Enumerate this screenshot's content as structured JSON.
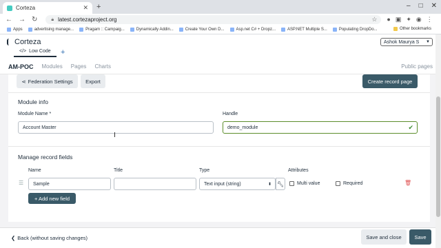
{
  "browser": {
    "tab_title": "Corteza",
    "url": "latest.cortezaproject.org",
    "bookmarks": [
      "Apps",
      "advertising manage...",
      "Pragam :: Campaig...",
      "Dynamically Addin...",
      "Create Your Own D...",
      "Asp.net C# + Dropz...",
      "ASP.NET Multiple S...",
      "Populating DropDo..."
    ],
    "other_bookmarks": "Other bookmarks"
  },
  "app": {
    "brand": "Corteza",
    "app_tab": "Low Code",
    "new_tab": "+",
    "user": "Ashok Maurya S",
    "namespace": "AM-POC",
    "nav": {
      "modules": "Modules",
      "pages": "Pages",
      "charts": "Charts",
      "public": "Public pages"
    }
  },
  "actions": {
    "federation": "Federation Settings",
    "export": "Export",
    "create_record_page": "Create record page"
  },
  "module_info": {
    "heading": "Module info",
    "name_label": "Module Name *",
    "name_value": "Account Master",
    "handle_label": "Handle",
    "handle_value": "demo_module"
  },
  "fields": {
    "heading": "Manage record fields",
    "col_name": "Name",
    "col_title": "Title",
    "col_type": "Type",
    "col_attributes": "Attributes",
    "rows": [
      {
        "name": "Sample",
        "title": "",
        "type": "Text input (string)",
        "multi_value": "Multi value",
        "required": "Required"
      }
    ],
    "add_button": "+ Add new field"
  },
  "footer": {
    "back": "Back (without saving changes)",
    "save_close": "Save and close",
    "save": "Save"
  }
}
